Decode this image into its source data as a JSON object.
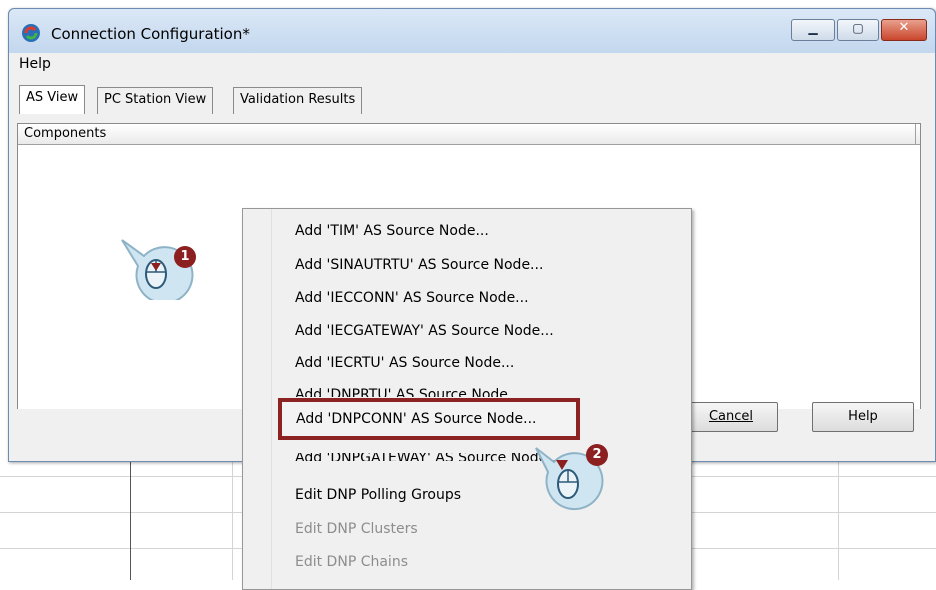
{
  "window": {
    "title": "Connection Configuration*",
    "menu": {
      "help": "Help"
    },
    "tabs": [
      "AS View",
      "PC Station View",
      "Validation Results"
    ],
    "panel_header": "Components",
    "buttons": {
      "cancel": "Cancel",
      "help": "Help"
    }
  },
  "context_menu": {
    "items": [
      {
        "label": "Add 'TIM' AS Source Node...",
        "enabled": true
      },
      {
        "label": "Add 'SINAUTRTU' AS Source Node...",
        "enabled": true
      },
      {
        "label": "Add 'IECCONN' AS Source Node...",
        "enabled": true
      },
      {
        "label": "Add 'IECGATEWAY' AS Source Node...",
        "enabled": true
      },
      {
        "label": "Add 'IECRTU' AS Source Node...",
        "enabled": true
      },
      {
        "label": "Add 'DNPRTU' AS Source Node...",
        "enabled": true
      },
      {
        "label": "Add 'DNPCONN' AS Source Node...",
        "enabled": true,
        "highlighted": true
      },
      {
        "label": "Add 'DNPGATEWAY' AS Source Node...",
        "enabled": true
      },
      {
        "label": "Edit DNP Polling Groups",
        "enabled": true
      },
      {
        "label": "Edit DNP Clusters",
        "enabled": false
      },
      {
        "label": "Edit DNP Chains",
        "enabled": false
      }
    ]
  },
  "callouts": [
    {
      "step": "1",
      "action": "right-click"
    },
    {
      "step": "2",
      "action": "left-click"
    }
  ],
  "colors": {
    "highlight_border": "#8c2222",
    "badge": "#8c1f1f",
    "callout_fill": "#cfe6f2"
  }
}
